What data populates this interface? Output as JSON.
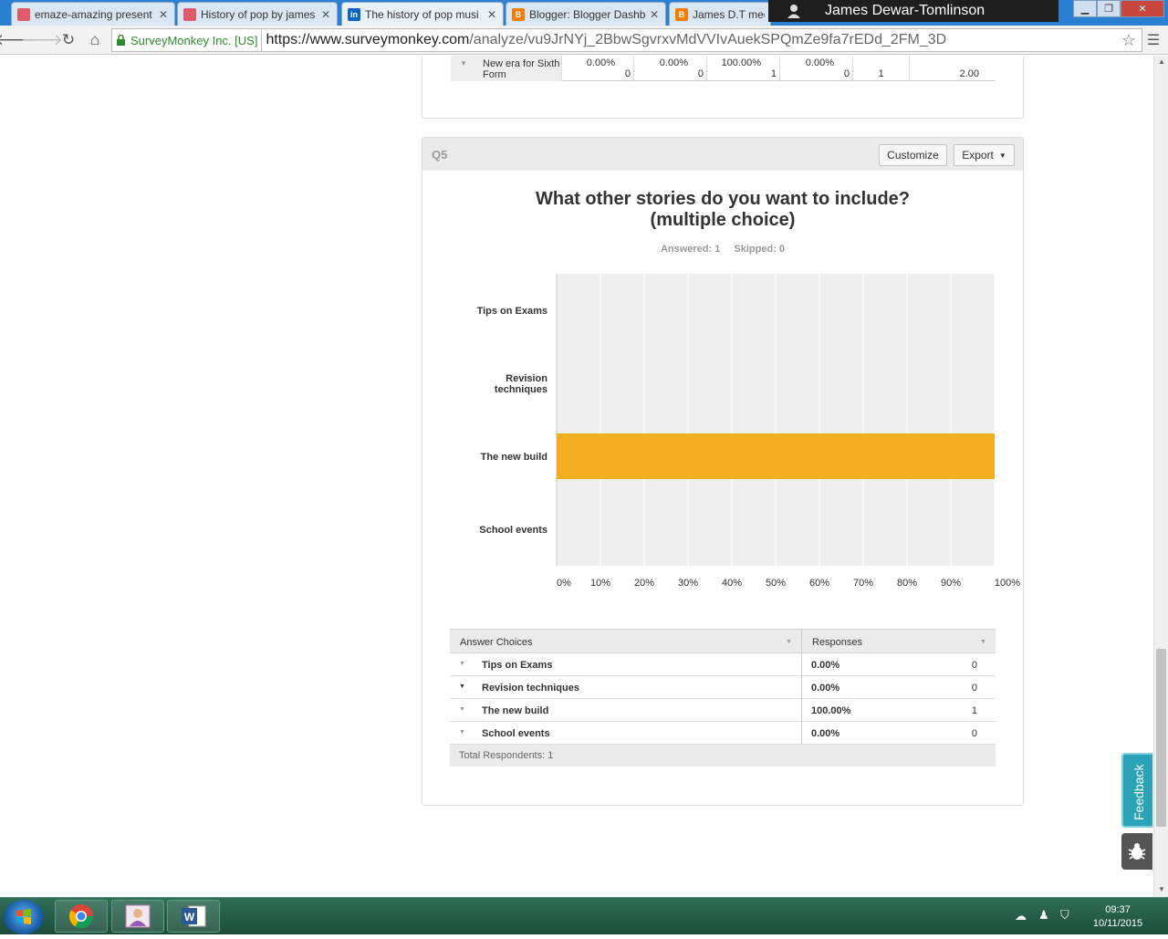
{
  "browser": {
    "tabs": [
      {
        "title": "emaze-amazing present",
        "favicon": "emaze-icon",
        "color": "#e05a6a"
      },
      {
        "title": "History of pop by james",
        "favicon": "emaze-icon",
        "color": "#e05a6a"
      },
      {
        "title": "The history of pop musi",
        "favicon": "linkedin-icon",
        "color": "#0a66c2"
      },
      {
        "title": "Blogger: Blogger Dashb",
        "favicon": "blogger-icon",
        "color": "#f57d00"
      },
      {
        "title": "James D.T medi",
        "favicon": "blogger-icon",
        "color": "#f57d00"
      }
    ],
    "user_name": "James Dewar-Tomlinson",
    "ev_label": "SurveyMonkey Inc. [US]",
    "url_host": "https://www.surveymonkey.com",
    "url_path": "/analyze/vu9JrNYj_2BbwSgvrxvMdVVIvAuekSPQmZe9fa7rEDd_2FM_3D"
  },
  "prev_question": {
    "row_label": "New era for Sixth Form",
    "cells": [
      {
        "pct": "0.00%",
        "count": "0"
      },
      {
        "pct": "0.00%",
        "count": "0"
      },
      {
        "pct": "100.00%",
        "count": "1"
      },
      {
        "pct": "0.00%",
        "count": "0"
      }
    ],
    "total": "1",
    "average": "2.00"
  },
  "question": {
    "label": "Q5",
    "customize_label": "Customize",
    "export_label": "Export",
    "title_line1": "What other stories do you want to include?",
    "title_line2": "(multiple choice)",
    "answered": "Answered: 1",
    "skipped": "Skipped: 0"
  },
  "chart_data": {
    "type": "bar",
    "orientation": "horizontal",
    "categories": [
      "Tips on Exams",
      "Revision techniques",
      "The new build",
      "School events"
    ],
    "values": [
      0,
      0,
      100,
      0
    ],
    "x_ticks": [
      "0%",
      "10%",
      "20%",
      "30%",
      "40%",
      "50%",
      "60%",
      "70%",
      "80%",
      "90%",
      "100%"
    ],
    "xlim": [
      0,
      100
    ],
    "grid": true,
    "bar_color": "#f5ae22",
    "plot_bg": "#efefef"
  },
  "table": {
    "col_answer": "Answer Choices",
    "col_responses": "Responses",
    "rows": [
      {
        "name": "Tips on Exams",
        "pct": "0.00%",
        "count": "0"
      },
      {
        "name": "Revision techniques",
        "pct": "0.00%",
        "count": "0"
      },
      {
        "name": "The new build",
        "pct": "100.00%",
        "count": "1"
      },
      {
        "name": "School events",
        "pct": "0.00%",
        "count": "0"
      }
    ],
    "total": "Total Respondents: 1"
  },
  "feedback_label": "Feedback",
  "clock": {
    "time": "09:37",
    "date": "10/11/2015"
  }
}
